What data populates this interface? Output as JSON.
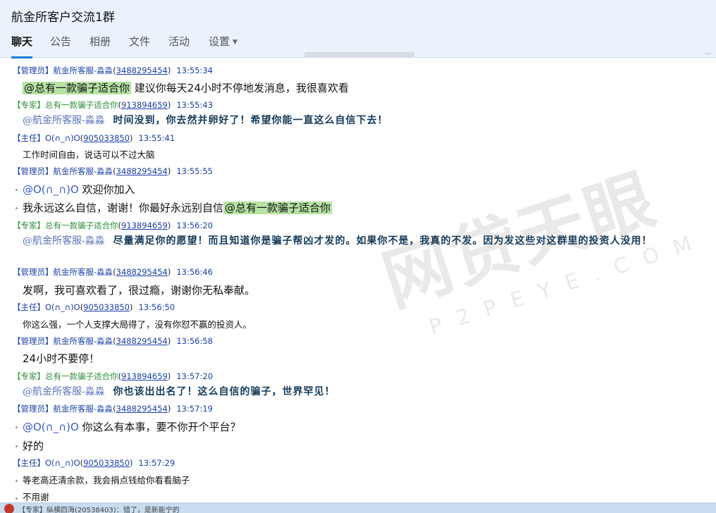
{
  "window": {
    "title": "航金所客户交流1群"
  },
  "tabs": [
    {
      "label": "聊天",
      "active": true
    },
    {
      "label": "公告"
    },
    {
      "label": "相册"
    },
    {
      "label": "文件"
    },
    {
      "label": "活动"
    },
    {
      "label": "设置"
    }
  ],
  "messages": [
    {
      "role": "【管理员】",
      "name": "航金所客服-淼淼",
      "qq": "3488295454",
      "time": "13:55:34",
      "mention": "@总有一款骗子适合你",
      "text": " 建议你每天24小时不停地发消息，我很喜欢看"
    },
    {
      "role": "【专家】",
      "name": "总有一款骗子适合你",
      "qq": "913894659",
      "time": "13:55:43",
      "mention": "@航金所客服-淼淼",
      "text": "时间没到，你去然并卵好了！希望你能一直这么自信下去！"
    },
    {
      "role": "【主任】",
      "name": "O(∩_∩)O",
      "qq": "905033850",
      "time": "13:55:41",
      "text": "工作时间自由，说话可以不过大脑"
    },
    {
      "role": "【管理员】",
      "name": "航金所客服-淼淼",
      "qq": "3488295454",
      "time": "13:55:55",
      "mention": "@O(∩_∩)O",
      "text": " 欢迎你加入",
      "text2": "我永远这么自信，谢谢！你最好永远别自信",
      "mention2": "@总有一款骗子适合你"
    },
    {
      "role": "【专家】",
      "name": "总有一款骗子适合你",
      "qq": "913894659",
      "time": "13:56:20",
      "mention": "@航金所客服-淼淼",
      "text": "尽量满足你的愿望！而且知道你是骗子帮凶才发的。如果你不是，我真的不发。因为发这些对这群里的投资人没用！"
    },
    {
      "role": "【管理员】",
      "name": "航金所客服-淼淼",
      "qq": "3488295454",
      "time": "13:56:46",
      "text": "发啊，我可喜欢看了，很过瘾，谢谢你无私奉献。"
    },
    {
      "role": "【主任】",
      "name": "O(∩_∩)O",
      "qq": "905033850",
      "time": "13:56:50",
      "text": "你这么强，一个人支撑大局得了，没有你怼不赢的投资人。"
    },
    {
      "role": "【管理员】",
      "name": "航金所客服-淼淼",
      "qq": "3488295454",
      "time": "13:56:58",
      "text": "24小时不要停！"
    },
    {
      "role": "【专家】",
      "name": "总有一款骗子适合你",
      "qq": "913894659",
      "time": "13:57:20",
      "mention": "@航金所客服-淼淼",
      "text": "你也该出出名了！这么自信的骗子，世界罕见！"
    },
    {
      "role": "【管理员】",
      "name": "航金所客服-淼淼",
      "qq": "3488295454",
      "time": "13:57:19",
      "mention": "@O(∩_∩)O",
      "text": " 你这么有本事，要不你开个平台？",
      "text2": "好的"
    },
    {
      "role": "【主任】",
      "name": "O(∩_∩)O",
      "qq": "905033850",
      "time": "13:57:29",
      "text": "等老高还清余款，我会捐点钱给你看看脑子",
      "text2": "不用谢"
    }
  ],
  "status": {
    "text": "【专家】纵横四海(20538403)：错了，是新能宁的"
  },
  "watermark": {
    "main": "网贷天眼",
    "sub": "P2PEYE.COM"
  }
}
